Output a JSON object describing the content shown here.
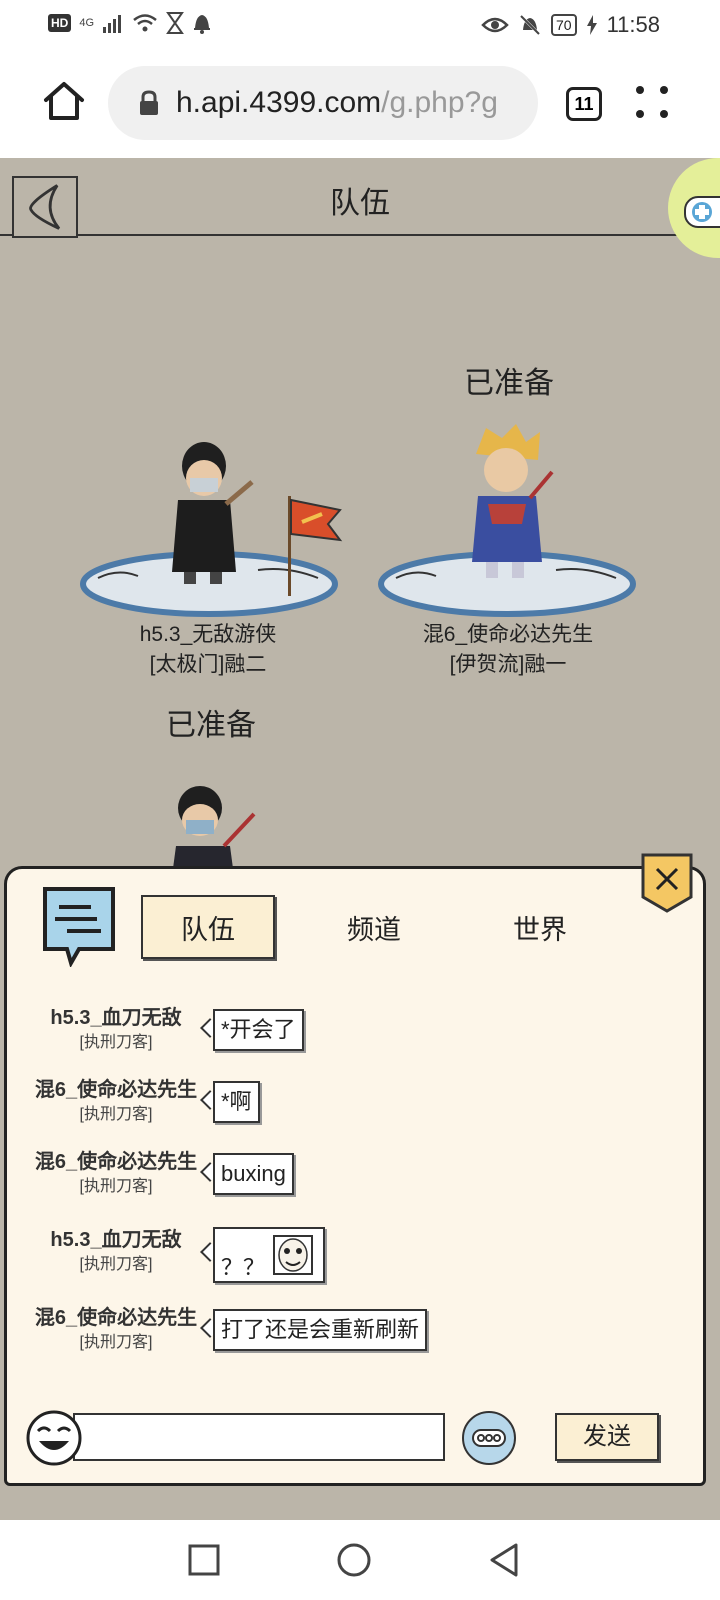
{
  "status_bar": {
    "hd": "HD",
    "network": "4G",
    "battery": "70",
    "time": "11:58"
  },
  "browser": {
    "url_host": "h.api.4399.com",
    "url_path": "/g.php?g",
    "tab_count": "11"
  },
  "game": {
    "title": "队伍",
    "players": [
      {
        "name": "h5.3_无敌游侠",
        "sect": "[太极门]融二",
        "status": ""
      },
      {
        "name": "混6_使命必达先生",
        "sect": "[伊贺流]融一",
        "status": "已准备"
      },
      {
        "name": "",
        "sect": "",
        "status": "已准备"
      }
    ]
  },
  "chat": {
    "tabs": [
      {
        "label": "队伍",
        "active": true
      },
      {
        "label": "频道",
        "active": false
      },
      {
        "label": "世界",
        "active": false
      }
    ],
    "messages": [
      {
        "sender": "h5.3_血刀无敌",
        "class": "[执刑刀客]",
        "text": "*开会了"
      },
      {
        "sender": "混6_使命必达先生",
        "class": "[执刑刀客]",
        "text": "*啊"
      },
      {
        "sender": "混6_使命必达先生",
        "class": "[执刑刀客]",
        "text": "buxing"
      },
      {
        "sender": "h5.3_血刀无敌",
        "class": "[执刑刀客]",
        "text": "？？"
      },
      {
        "sender": "混6_使命必达先生",
        "class": "[执刑刀客]",
        "text": "打了还是会重新刷新"
      }
    ],
    "input_value": "",
    "send_label": "发送"
  }
}
